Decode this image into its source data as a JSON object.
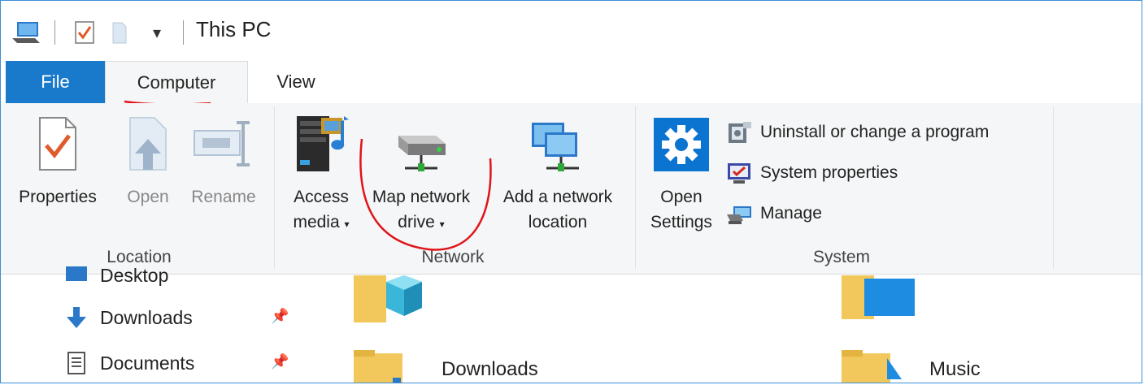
{
  "window": {
    "title": "This PC"
  },
  "quick_access": {
    "icons": [
      "this-pc-icon",
      "properties-check-icon",
      "new-folder-icon",
      "customize-arrow-icon"
    ],
    "arrow_glyph": "▾"
  },
  "tabs": [
    {
      "label": "File"
    },
    {
      "label": "Computer"
    },
    {
      "label": "View"
    }
  ],
  "ribbon": {
    "location": {
      "label": "Location",
      "buttons": [
        {
          "label": "Properties"
        },
        {
          "label": "Open"
        },
        {
          "label": "Rename"
        }
      ]
    },
    "network": {
      "label": "Network",
      "buttons": [
        {
          "label_line1": "Access",
          "label_line2": "media",
          "caret": "▾"
        },
        {
          "label_line1": "Map network",
          "label_line2": "drive",
          "caret": "▾"
        },
        {
          "label_line1": "Add a network",
          "label_line2": "location"
        }
      ]
    },
    "system": {
      "label": "System",
      "open_settings_line1": "Open",
      "open_settings_line2": "Settings",
      "items": [
        {
          "label": "Uninstall or change a program"
        },
        {
          "label": "System properties"
        },
        {
          "label": "Manage"
        }
      ]
    }
  },
  "nav_pane": {
    "items": [
      {
        "label": "Desktop"
      },
      {
        "label": "Downloads"
      },
      {
        "label": "Documents"
      }
    ],
    "pin_glyph": "📌"
  },
  "content": {
    "folders": [
      {
        "label": "Downloads"
      },
      {
        "label": "Music"
      }
    ]
  },
  "colors": {
    "accent": "#1979ca",
    "annotation": "#e0141a",
    "ribbon_bg": "#f5f6f7"
  }
}
